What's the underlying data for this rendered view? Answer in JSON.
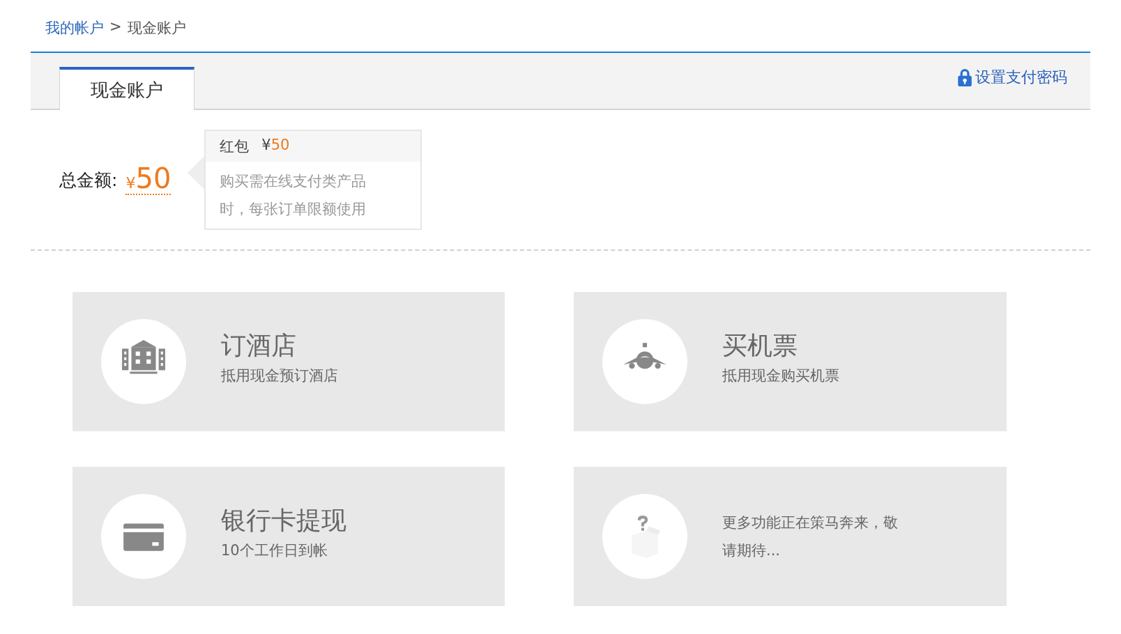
{
  "breadcrumb": {
    "link": "我的帐户",
    "separator": ">",
    "current": "现金账户"
  },
  "tabs": [
    {
      "label": "现金账户",
      "selected": true
    }
  ],
  "pay_password_link": "设置支付密码",
  "total": {
    "label": "总金额:",
    "currency": "¥",
    "amount": "50"
  },
  "popover": {
    "label": "红包",
    "currency": "¥",
    "amount": "50",
    "description": "购买需在线支付类产品时，每张订单限额使用"
  },
  "cards": [
    {
      "kind": "feature",
      "title": "订酒店",
      "subtitle": "抵用现金预订酒店"
    },
    {
      "kind": "feature",
      "title": "买机票",
      "subtitle": "抵用现金购买机票"
    },
    {
      "kind": "feature",
      "title": "银行卡提现",
      "subtitle": "10个工作日到帐"
    },
    {
      "kind": "notice",
      "text": "更多功能正在策马奔来，敬请期待..."
    }
  ]
}
